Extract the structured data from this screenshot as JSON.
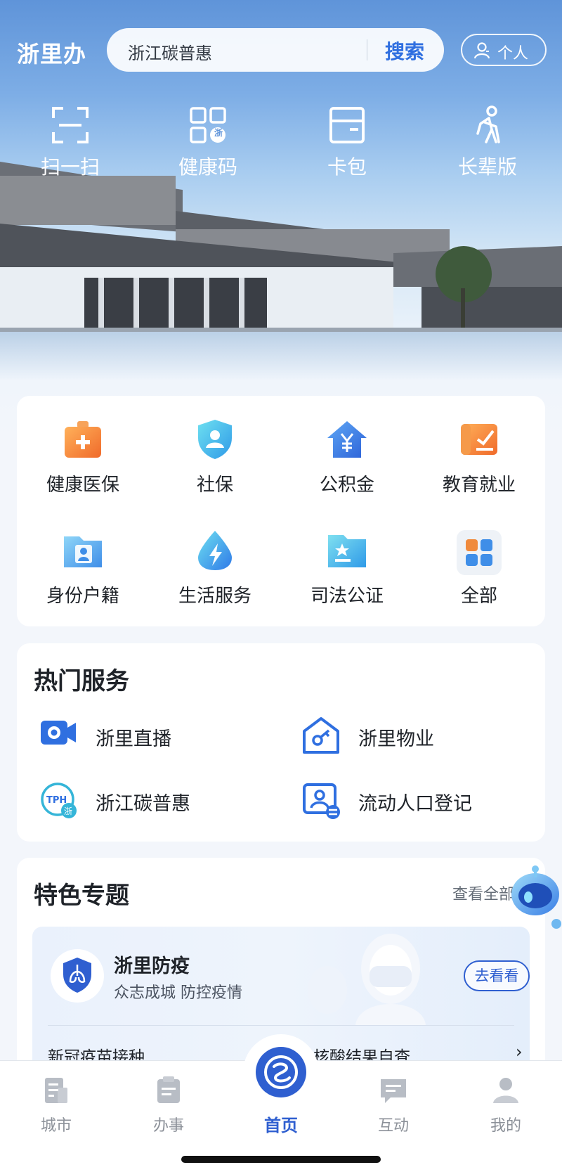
{
  "header": {
    "brand": "浙里办",
    "search_text": "浙江碳普惠",
    "search_button": "搜索",
    "personal_button": "个人"
  },
  "quick_actions": [
    {
      "label": "扫一扫",
      "icon": "scan-icon"
    },
    {
      "label": "健康码",
      "icon": "health-code-icon"
    },
    {
      "label": "卡包",
      "icon": "card-wallet-icon"
    },
    {
      "label": "长辈版",
      "icon": "elder-mode-icon"
    }
  ],
  "services": [
    {
      "label": "健康医保",
      "icon": "medical-kit-icon"
    },
    {
      "label": "社保",
      "icon": "shield-person-icon"
    },
    {
      "label": "公积金",
      "icon": "house-yuan-icon"
    },
    {
      "label": "教育就业",
      "icon": "education-icon"
    },
    {
      "label": "身份户籍",
      "icon": "id-folder-icon"
    },
    {
      "label": "生活服务",
      "icon": "drop-lightning-icon"
    },
    {
      "label": "司法公证",
      "icon": "justice-folder-icon"
    },
    {
      "label": "全部",
      "icon": "grid-all-icon"
    }
  ],
  "hot_services": {
    "title": "热门服务",
    "items": [
      {
        "label": "浙里直播",
        "icon": "video-camera-icon"
      },
      {
        "label": "浙里物业",
        "icon": "property-key-icon"
      },
      {
        "label": "浙江碳普惠",
        "icon": "tph-icon",
        "icon_text": "TPH",
        "icon_badge": "浙"
      },
      {
        "label": "流动人口登记",
        "icon": "population-register-icon"
      }
    ]
  },
  "featured": {
    "title": "特色专题",
    "more": "查看全部",
    "banner": {
      "title": "浙里防疫",
      "subtitle": "众志成城 防控疫情",
      "action": "去看看",
      "links": [
        "新冠疫苗接种",
        "核酸结果自查"
      ]
    }
  },
  "badges": {
    "health_code_badge": "浙"
  },
  "bottom_nav": [
    {
      "label": "城市",
      "icon": "city-icon"
    },
    {
      "label": "办事",
      "icon": "affairs-icon"
    },
    {
      "label": "首页",
      "icon": "home-logo-icon",
      "active": true
    },
    {
      "label": "互动",
      "icon": "chat-icon"
    },
    {
      "label": "我的",
      "icon": "profile-icon"
    }
  ],
  "colors": {
    "accent": "#2f5fd0",
    "hero_sky": "#5f94d9",
    "orange": "#f08a3c",
    "nav_inactive": "#8c9199"
  }
}
